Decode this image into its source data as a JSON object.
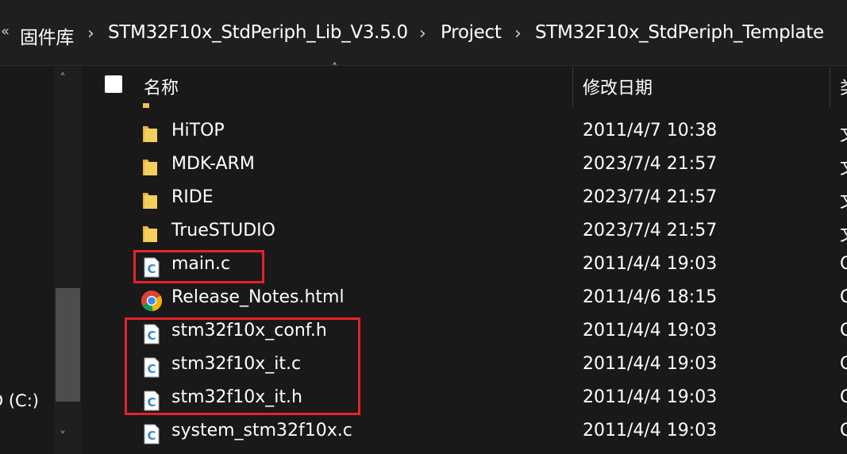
{
  "breadcrumb": {
    "overflow": "«",
    "items": [
      "固件库",
      "STM32F10x_StdPeriph_Lib_V3.5.0",
      "Project",
      "STM32F10x_StdPeriph_Template"
    ],
    "separator": "›"
  },
  "nav": {
    "drive_label": "D (C:)",
    "scroll_up": "˄",
    "scroll_down": "˅"
  },
  "header": {
    "sort_indicator": "˄",
    "name_label": "名称",
    "date_label": "修改日期",
    "type_label": "类"
  },
  "rows": [
    {
      "name": "HiTOP",
      "date": "2011/4/7 10:38",
      "type": "文",
      "icon": "folder-icon"
    },
    {
      "name": "MDK-ARM",
      "date": "2023/7/4 21:57",
      "type": "文",
      "icon": "folder-icon"
    },
    {
      "name": "RIDE",
      "date": "2023/7/4 21:57",
      "type": "文",
      "icon": "folder-icon"
    },
    {
      "name": "TrueSTUDIO",
      "date": "2023/7/4 21:57",
      "type": "文",
      "icon": "folder-icon"
    },
    {
      "name": "main.c",
      "date": "2011/4/4 19:03",
      "type": "C",
      "icon": "c-file-icon"
    },
    {
      "name": "Release_Notes.html",
      "date": "2011/4/6 18:15",
      "type": "C",
      "icon": "chrome-icon"
    },
    {
      "name": "stm32f10x_conf.h",
      "date": "2011/4/4 19:03",
      "type": "C",
      "icon": "h-file-icon"
    },
    {
      "name": "stm32f10x_it.c",
      "date": "2011/4/4 19:03",
      "type": "C",
      "icon": "c-file-icon"
    },
    {
      "name": "stm32f10x_it.h",
      "date": "2011/4/4 19:03",
      "type": "C",
      "icon": "h-file-icon"
    },
    {
      "name": "system_stm32f10x.c",
      "date": "2011/4/4 19:03",
      "type": "C",
      "icon": "c-file-icon"
    }
  ],
  "colors": {
    "background": "#191919",
    "annotation": "#e4222b",
    "folder": "#f0c14b"
  }
}
